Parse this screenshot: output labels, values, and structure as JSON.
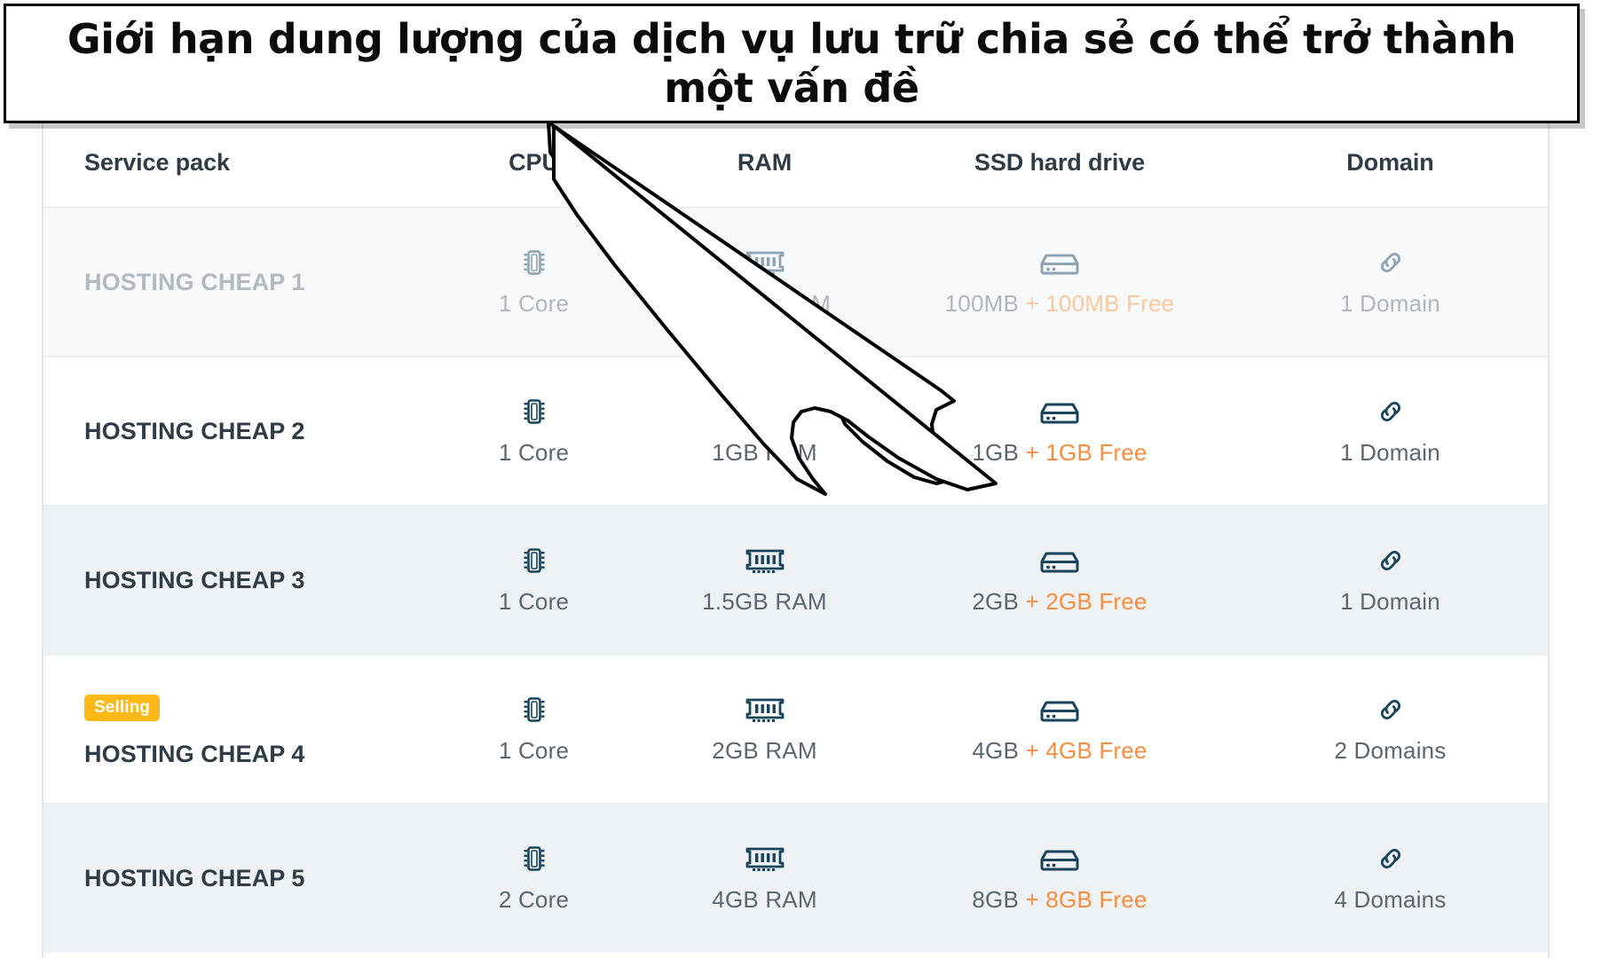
{
  "callout": {
    "text": "Giới hạn dung lượng của dịch vụ lưu trữ chia sẻ có thể trở thành một vấn đề",
    "border_color": "#000000",
    "background": "#ffffff",
    "arrow": "arrow-pointing-to-ssd-column"
  },
  "table": {
    "headers": {
      "service_pack": "Service pack",
      "cpu": "CPU",
      "ram": "RAM",
      "ssd": "SSD hard drive",
      "domain": "Domain"
    },
    "icons": {
      "cpu": "cpu-chip-icon",
      "ram": "ram-module-icon",
      "ssd": "hard-drive-icon",
      "domain": "link-chain-icon"
    },
    "colors": {
      "heading": "#2f3b47",
      "body_text": "#5b6670",
      "free_accent": "#fd8c3c",
      "badge_background": "#fbb817",
      "icon_active": "#17435c",
      "icon_muted": "#8ba3b4",
      "row_shade": "#eef2f5"
    },
    "rows": [
      {
        "name": "HOSTING CHEAP 1",
        "badge": "",
        "cpu": "1 Core",
        "ram": "500MB RAM",
        "ssd_base": "100MB",
        "ssd_free": "+ 100MB Free",
        "domain": "1 Domain",
        "muted": true
      },
      {
        "name": "HOSTING CHEAP 2",
        "badge": "",
        "cpu": "1 Core",
        "ram": "1GB RAM",
        "ssd_base": "1GB",
        "ssd_free": "+ 1GB Free",
        "domain": "1 Domain",
        "muted": false
      },
      {
        "name": "HOSTING CHEAP 3",
        "badge": "",
        "cpu": "1 Core",
        "ram": "1.5GB RAM",
        "ssd_base": "2GB",
        "ssd_free": "+ 2GB Free",
        "domain": "1 Domain",
        "muted": false
      },
      {
        "name": "HOSTING CHEAP 4",
        "badge": "Selling",
        "cpu": "1 Core",
        "ram": "2GB RAM",
        "ssd_base": "4GB",
        "ssd_free": "+ 4GB Free",
        "domain": "2 Domains",
        "muted": false
      },
      {
        "name": "HOSTING CHEAP 5",
        "badge": "",
        "cpu": "2 Core",
        "ram": "4GB RAM",
        "ssd_base": "8GB",
        "ssd_free": "+ 8GB Free",
        "domain": "4 Domains",
        "muted": false
      }
    ]
  }
}
